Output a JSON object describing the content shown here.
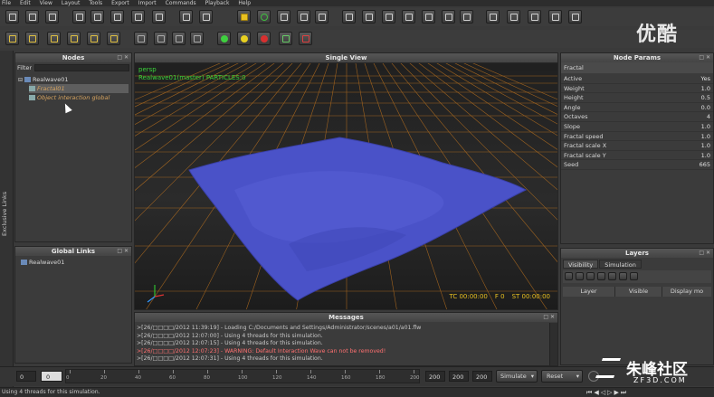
{
  "menu": [
    "File",
    "Edit",
    "View",
    "Layout",
    "Tools",
    "Export",
    "Import",
    "Commands",
    "Playback",
    "Help"
  ],
  "watermark": {
    "logo_text": "优酷",
    "bottom_text": "朱峰社区",
    "bottom_sub": "ZF3D.COM"
  },
  "nodes": {
    "title": "Nodes",
    "filter_label": "Filter",
    "root": "Realwave01",
    "child1": "Fractal01",
    "child2": "Object interaction global"
  },
  "side_tab": "Exclusive Links",
  "global_links": {
    "title": "Global Links",
    "item": "Realwave01"
  },
  "viewport": {
    "title": "Single View",
    "camera": "persp",
    "info": "Realwave01(master) PARTICLES:0",
    "tc": "TC 00:00:00",
    "f": "F 0",
    "st": "ST 00:00:00"
  },
  "messages": {
    "title": "Messages",
    "lines": [
      ">[26/□□□□/2012 11:39:19] - Loading C:/Documents and Settings/Administrator/scenes/a01/a01.flw",
      ">[26/□□□□/2012 12:07:00] - Using 4 threads for this simulation.",
      ">[26/□□□□/2012 12:07:15] - Using 4 threads for this simulation.",
      ">[26/□□□□/2012 12:07:23] - WARNING: Default Interaction Wave can not be removed!",
      ">[26/□□□□/2012 12:07:31] - Using 4 threads for this simulation."
    ]
  },
  "node_params": {
    "title": "Node Params",
    "section": "Fractal",
    "rows": [
      {
        "k": "Active",
        "v": "Yes"
      },
      {
        "k": "Weight",
        "v": "1.0"
      },
      {
        "k": "Height",
        "v": "0.5"
      },
      {
        "k": "Angle",
        "v": "0.0"
      },
      {
        "k": "Octaves",
        "v": "4"
      },
      {
        "k": "Slope",
        "v": "1.0"
      },
      {
        "k": "Fractal speed",
        "v": "1.0"
      },
      {
        "k": "Fractal scale X",
        "v": "1.0"
      },
      {
        "k": "Fractal scale Y",
        "v": "1.0"
      },
      {
        "k": "Seed",
        "v": "665"
      }
    ]
  },
  "layers": {
    "title": "Layers",
    "tab1": "Visibility",
    "tab2": "Simulation",
    "col1": "Layer",
    "col2": "Visible",
    "col3": "Display mo"
  },
  "timeline": {
    "start": "0",
    "current": "0",
    "ticks": [
      "0",
      "20",
      "40",
      "60",
      "80",
      "100",
      "120",
      "140",
      "160",
      "180",
      "200"
    ],
    "end1": "200",
    "end2": "200",
    "end3": "200",
    "simulate": "Simulate",
    "reset": "Reset"
  },
  "status": "Using 4 threads for this simulation.",
  "colors": {
    "water": "#4a52c8",
    "grid": "#c8781e",
    "accent": "#ff9a2a"
  }
}
